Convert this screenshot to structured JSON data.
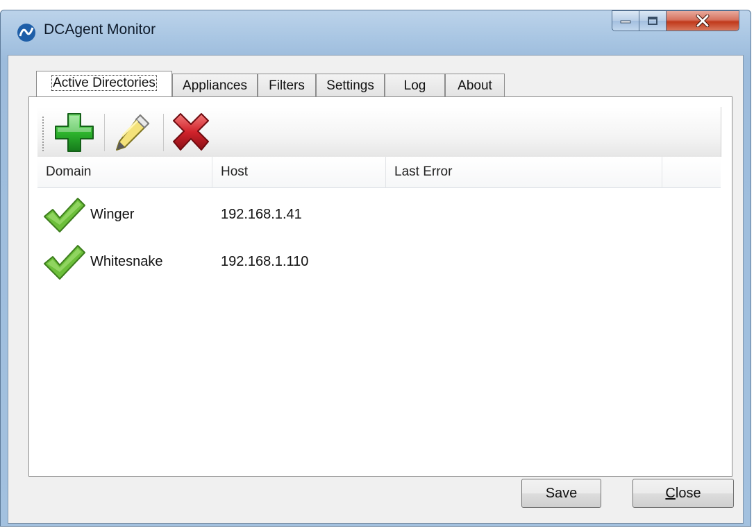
{
  "window": {
    "title": "DCAgent Monitor",
    "controls": {
      "minimize_icon": "minimize-icon",
      "maximize_icon": "maximize-icon",
      "close_icon": "close-icon"
    }
  },
  "tabs": [
    {
      "label": "Active Directories",
      "active": true
    },
    {
      "label": "Appliances",
      "active": false
    },
    {
      "label": "Filters",
      "active": false
    },
    {
      "label": "Settings",
      "active": false
    },
    {
      "label": "Log",
      "active": false
    },
    {
      "label": "About",
      "active": false
    }
  ],
  "toolbar": {
    "add_icon": "add-icon",
    "edit_icon": "pencil-icon",
    "delete_icon": "delete-icon"
  },
  "table": {
    "columns": [
      "Domain",
      "Host",
      "Last Error"
    ],
    "rows": [
      {
        "status_icon": "checkmark-icon",
        "domain": "Winger",
        "host": "192.168.1.41",
        "last_error": ""
      },
      {
        "status_icon": "checkmark-icon",
        "domain": "Whitesnake",
        "host": "192.168.1.110",
        "last_error": ""
      }
    ]
  },
  "buttons": {
    "save_label": "Save",
    "close_label": "Close",
    "close_mnemonic": "C"
  },
  "colors": {
    "title_bar": "#a9c6e3",
    "close_button": "#c0381a",
    "add_green": "#2db52d",
    "delete_red": "#c8202a",
    "check_green": "#6cbf3a"
  }
}
